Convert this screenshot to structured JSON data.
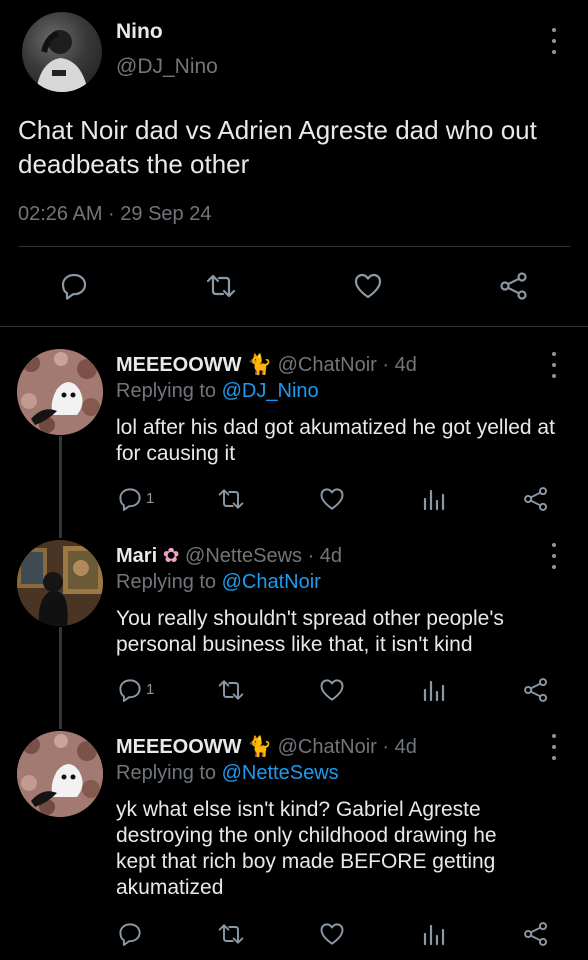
{
  "main_tweet": {
    "display_name": "Nino",
    "handle": "@DJ_Nino",
    "text": "Chat Noir dad vs Adrien Agreste dad who out deadbeats the other",
    "timestamp": "02:26 AM · 29 Sep 24"
  },
  "replies": [
    {
      "display_name": "MEEEOOWW",
      "emoji": "🐈‍⬛",
      "handle": "@ChatNoir",
      "age": "· 4d",
      "replying_label": "Replying to",
      "replying_to": "@DJ_Nino",
      "text": "lol after his dad got akumatized he got yelled at for causing it",
      "reply_count": "1"
    },
    {
      "display_name": "Mari",
      "emoji": "🪷",
      "handle": "@NetteSews",
      "age": "· 4d",
      "replying_label": "Replying to",
      "replying_to": "@ChatNoir",
      "text": "You really shouldn't spread other people's personal business like that, it isn't kind",
      "reply_count": "1"
    },
    {
      "display_name": "MEEEOOWW",
      "emoji": "🐈‍⬛",
      "handle": "@ChatNoir",
      "age": "· 4d",
      "replying_label": "Replying to",
      "replying_to": "@NetteSews",
      "text": "yk what else isn't kind? Gabriel Agreste destroying the only childhood drawing  he kept that rich boy made BEFORE getting akumatized",
      "reply_count": ""
    }
  ],
  "icons": {
    "reply": "reply-icon",
    "retweet": "retweet-icon",
    "like": "heart-icon",
    "views": "views-icon",
    "share": "share-icon",
    "more": "more-options-icon"
  },
  "colors": {
    "background": "#000000",
    "text": "#e7e9ea",
    "muted": "#71767b",
    "link": "#1d9bf0",
    "icon": "#8b98a5"
  }
}
